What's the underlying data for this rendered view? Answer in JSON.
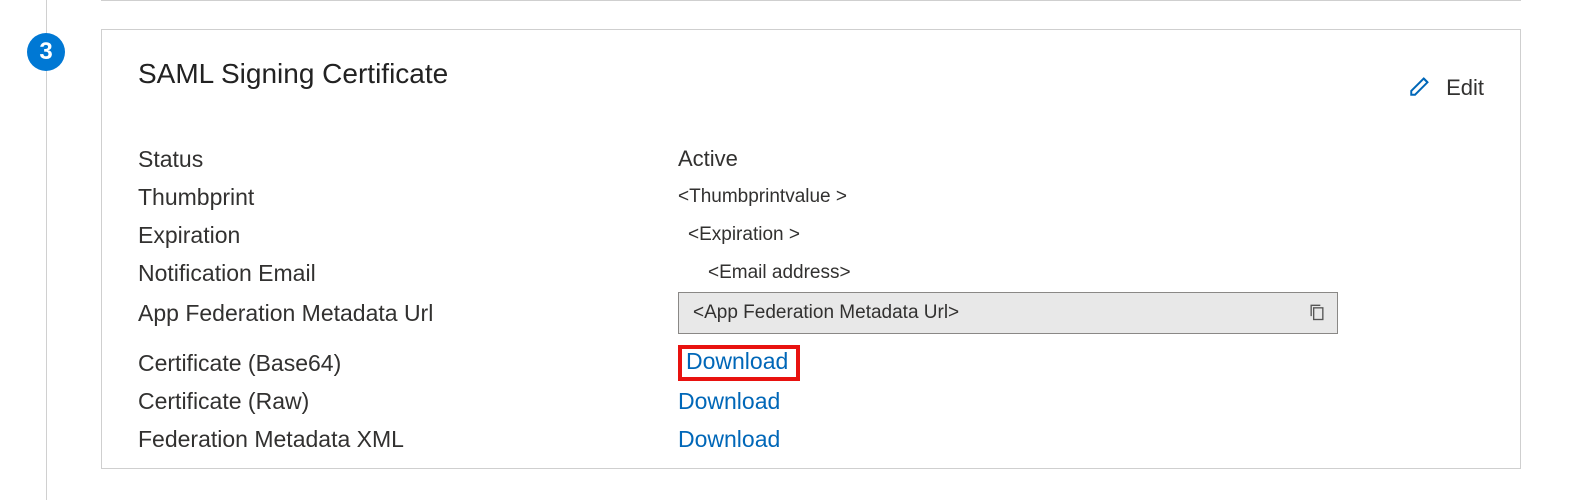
{
  "step": {
    "number": "3"
  },
  "card": {
    "title": "SAML Signing Certificate",
    "editLabel": "Edit"
  },
  "rows": {
    "status": {
      "label": "Status",
      "value": "Active"
    },
    "thumbprint": {
      "label": "Thumbprint",
      "value": "<Thumbprintvalue >"
    },
    "expiration": {
      "label": "Expiration",
      "value": "<Expiration >"
    },
    "notificationEmail": {
      "label": "Notification Email",
      "value": "<Email address>"
    },
    "appFedUrl": {
      "label": "App Federation Metadata Url",
      "value": "<App Federation Metadata Url>"
    },
    "certBase64": {
      "label": "Certificate (Base64)",
      "action": "Download"
    },
    "certRaw": {
      "label": "Certificate (Raw)",
      "action": "Download"
    },
    "fedXml": {
      "label": "Federation Metadata XML",
      "action": "Download"
    }
  }
}
